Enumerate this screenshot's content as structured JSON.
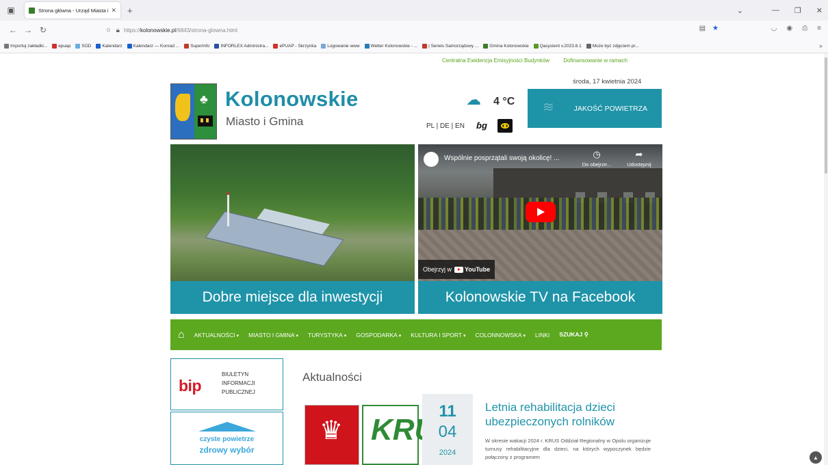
{
  "browser": {
    "tab_title": "Strona główna - Urząd Miasta i",
    "url_prefix": "https://",
    "url_domain": "kolonowskie.pl",
    "url_path": "/6843/strona-glowna.html",
    "bookmarks": [
      {
        "label": "Importuj zakładki...",
        "color": "#777"
      },
      {
        "label": "epuap",
        "color": "#d0312d"
      },
      {
        "label": "SOD",
        "color": "#6aaee0"
      },
      {
        "label": "Kalendarz",
        "color": "#1a5fd0"
      },
      {
        "label": "Kalendarz — Konrad ...",
        "color": "#1a5fd0"
      },
      {
        "label": "SuperInfo",
        "color": "#c0392b"
      },
      {
        "label": "INFORLEX Administra...",
        "color": "#2a4fa0"
      },
      {
        "label": "ePUAP - Skrzynka",
        "color": "#d0312d"
      },
      {
        "label": "Logowanie www",
        "color": "#7aa7d8"
      },
      {
        "label": "Wetter Kolonowskie - ...",
        "color": "#2c7ab5"
      },
      {
        "label": "| Serwis Samorządowy ...",
        "color": "#c0392b"
      },
      {
        "label": "Gmina Kolonowskie",
        "color": "#3a7d2a"
      },
      {
        "label": "Qasystent v.2023.8.1",
        "color": "#5a9a2a"
      },
      {
        "label": "Może być zdjęciem pr...",
        "color": "#666"
      }
    ]
  },
  "site": {
    "top_links": [
      "Centralna Ewidencja Emisyjności Budynków",
      "Dofinansowanie w ramach"
    ],
    "date": "środa, 17 kwietnia 2024",
    "title": "Kolonowskie",
    "subtitle": "Miasto i Gmina",
    "temperature": "4 °C",
    "languages": "PL | DE | EN",
    "air_quality": "JAKOŚĆ POWIETRZA"
  },
  "hero": {
    "left_caption": "Dobre miejsce dla inwestycji",
    "right_caption": "Kolonowskie TV na Facebook",
    "video_title": "Wspólnie posprzątali swoją okolicę! ...",
    "watch_later": "Do obejrze...",
    "share": "Udostępnij",
    "watch_on": "Obejrzyj w",
    "youtube": "YouTube"
  },
  "menu": {
    "items": [
      {
        "label": "AKTUALNOŚCI",
        "caret": true
      },
      {
        "label": "MIASTO I GMINA",
        "caret": true
      },
      {
        "label": "TURYSTYKA",
        "caret": true
      },
      {
        "label": "GOSPODARKA",
        "caret": true
      },
      {
        "label": "KULTURA I SPORT",
        "caret": true
      },
      {
        "label": "COLONNOWSKA",
        "caret": true
      },
      {
        "label": "LINKI",
        "caret": false
      }
    ],
    "search": "SZUKAJ"
  },
  "sidebar": {
    "bip_logo": "bip",
    "bip_lines": [
      "BIULETYN",
      "INFORMACJI",
      "PUBLICZNEJ"
    ],
    "czyste_line1": "czyste powietrze",
    "czyste_line2": "zdrowy wybór"
  },
  "news": {
    "heading": "Aktualności",
    "day": "11",
    "month": "04",
    "year": "2024",
    "title": "Letnia rehabilitacja dzieci ubezpieczonych rolników",
    "text": "W okresie wakacji 2024 r. KRUS Oddział Regionalny w Opolu organizuje turnusy rehabilitacyjne dla dzieci, na których wypoczynek będzie połączony z programem",
    "krus_logo": "KRUS"
  }
}
